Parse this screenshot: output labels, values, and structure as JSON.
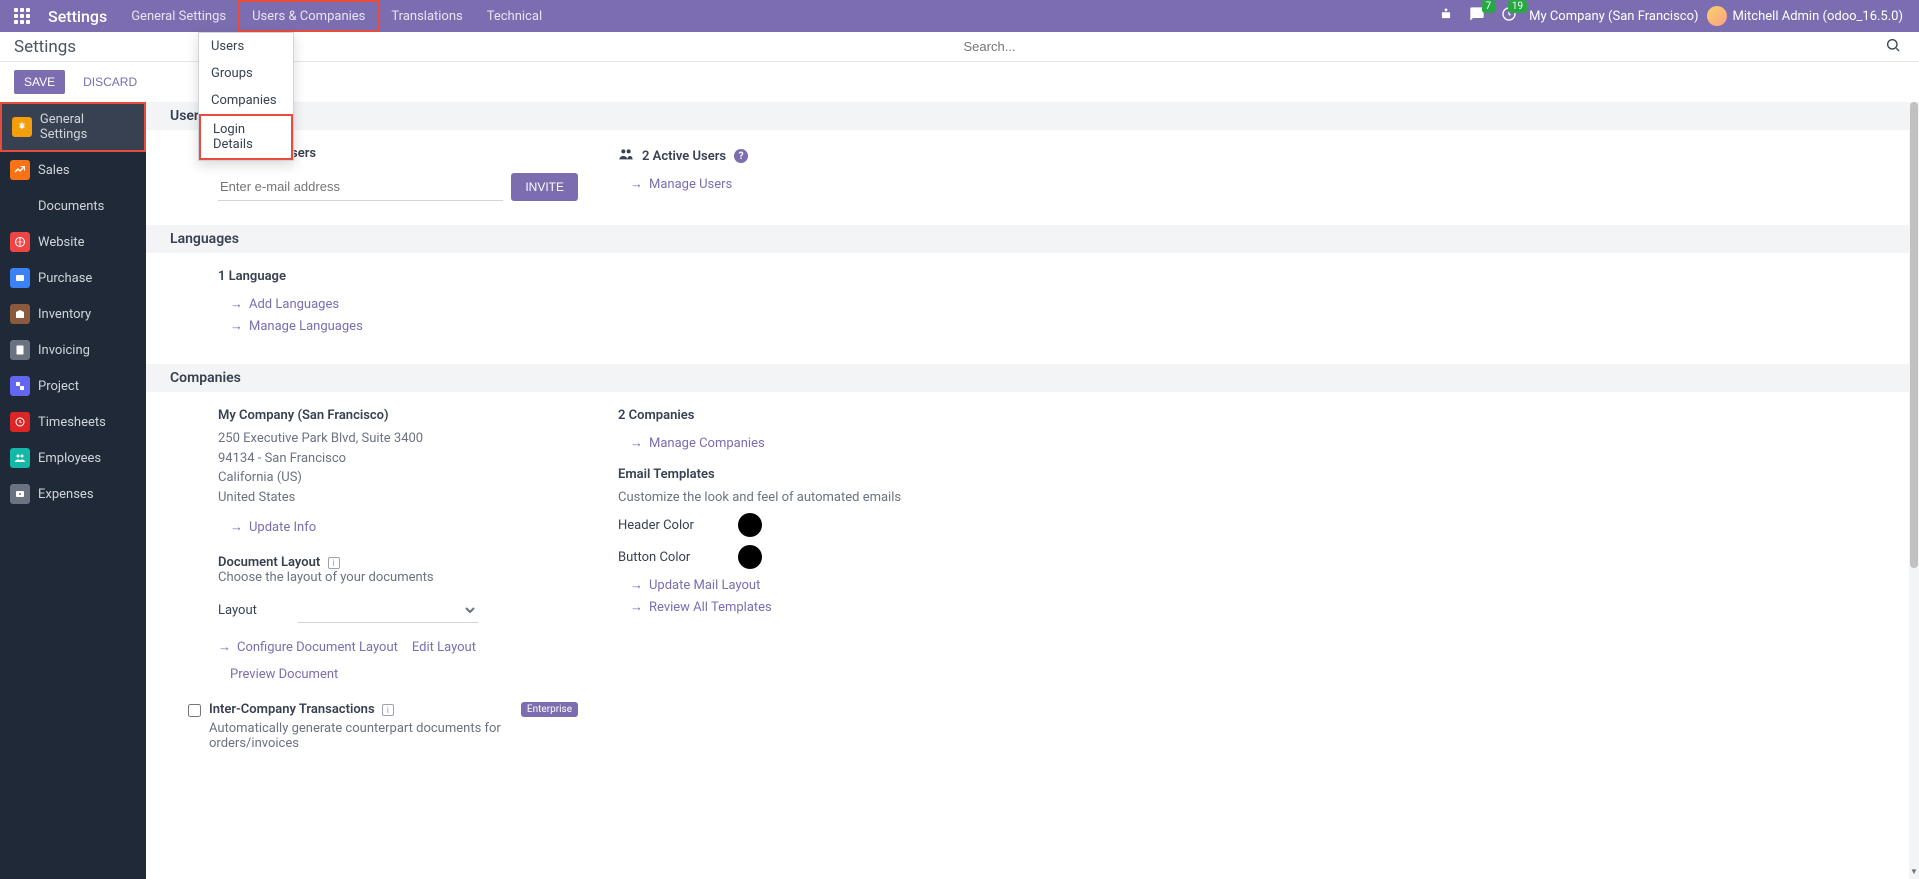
{
  "navbar": {
    "title": "Settings",
    "menu": [
      {
        "label": "General Settings"
      },
      {
        "label": "Users & Companies"
      },
      {
        "label": "Translations"
      },
      {
        "label": "Technical"
      }
    ],
    "messages_badge": "7",
    "activities_badge": "19",
    "company": "My Company (San Francisco)",
    "user": "Mitchell Admin (odoo_16.5.0)"
  },
  "dropdown": {
    "items": [
      {
        "label": "Users"
      },
      {
        "label": "Groups"
      },
      {
        "label": "Companies"
      },
      {
        "label": "Login Details"
      }
    ]
  },
  "header": {
    "page_title": "Settings",
    "search_placeholder": "Search..."
  },
  "actions": {
    "save": "SAVE",
    "discard": "DISCARD"
  },
  "sidebar": {
    "items": [
      {
        "label": "General Settings"
      },
      {
        "label": "Sales"
      },
      {
        "label": "Documents"
      },
      {
        "label": "Website"
      },
      {
        "label": "Purchase"
      },
      {
        "label": "Inventory"
      },
      {
        "label": "Invoicing"
      },
      {
        "label": "Project"
      },
      {
        "label": "Timesheets"
      },
      {
        "label": "Employees"
      },
      {
        "label": "Expenses"
      }
    ]
  },
  "sections": {
    "users": {
      "header": "User",
      "invite_label": "Invite New Users",
      "invite_placeholder": "Enter e-mail address",
      "invite_button": "INVITE",
      "active_users": "2 Active Users",
      "manage_users": "Manage Users"
    },
    "languages": {
      "header": "Languages",
      "count": "1 Language",
      "add": "Add Languages",
      "manage": "Manage Languages"
    },
    "companies": {
      "header": "Companies",
      "my_company_name": "My Company (San Francisco)",
      "address_line1": "250 Executive Park Blvd, Suite 3400",
      "address_line2": "94134 - San Francisco",
      "address_state": "California (US)",
      "address_country": "United States",
      "update_info": "Update Info",
      "doc_layout_label": "Document Layout",
      "doc_layout_desc": "Choose the layout of your documents",
      "layout_label": "Layout",
      "configure_layout": "Configure Document Layout",
      "edit_layout": "Edit Layout",
      "preview_document": "Preview Document",
      "companies_count": "2 Companies",
      "manage_companies": "Manage Companies",
      "email_templates_label": "Email Templates",
      "email_templates_desc": "Customize the look and feel of automated emails",
      "header_color_label": "Header Color",
      "button_color_label": "Button Color",
      "header_color": "#000000",
      "button_color": "#000000",
      "update_mail_layout": "Update Mail Layout",
      "review_templates": "Review All Templates",
      "intercompany_label": "Inter-Company Transactions",
      "intercompany_desc": "Automatically generate counterpart documents for orders/invoices",
      "enterprise_tag": "Enterprise"
    }
  }
}
